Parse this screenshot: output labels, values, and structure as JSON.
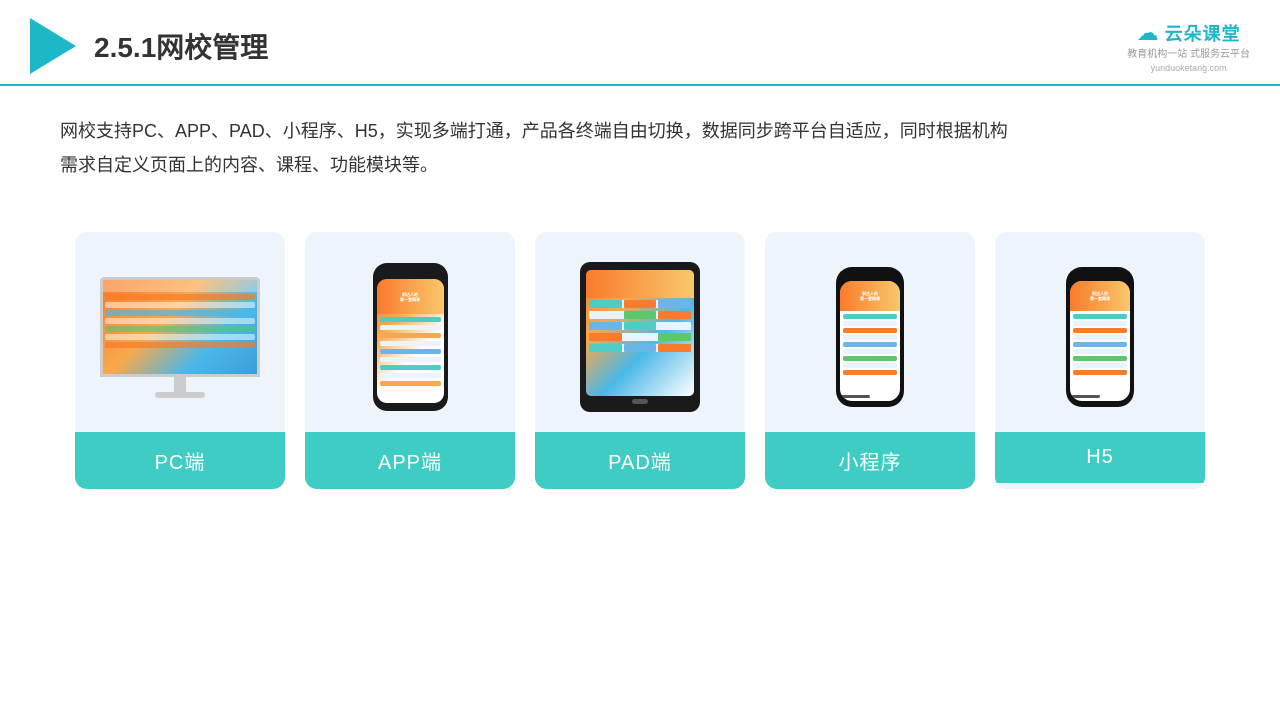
{
  "header": {
    "title": "2.5.1网校管理",
    "brand": {
      "name": "云朵课堂",
      "url": "yunduoketang.com",
      "tagline": "教育机构一站\n式服务云平台"
    }
  },
  "description": "网校支持PC、APP、PAD、小程序、H5，实现多端打通，产品各终端自由切换，数据同步跨平台自适应，同时根据机构\n需求自定义页面上的内容、课程、功能模块等。",
  "cards": [
    {
      "id": "pc",
      "label": "PC端"
    },
    {
      "id": "app",
      "label": "APP端"
    },
    {
      "id": "pad",
      "label": "PAD端"
    },
    {
      "id": "miniprogram",
      "label": "小程序"
    },
    {
      "id": "h5",
      "label": "H5"
    }
  ]
}
